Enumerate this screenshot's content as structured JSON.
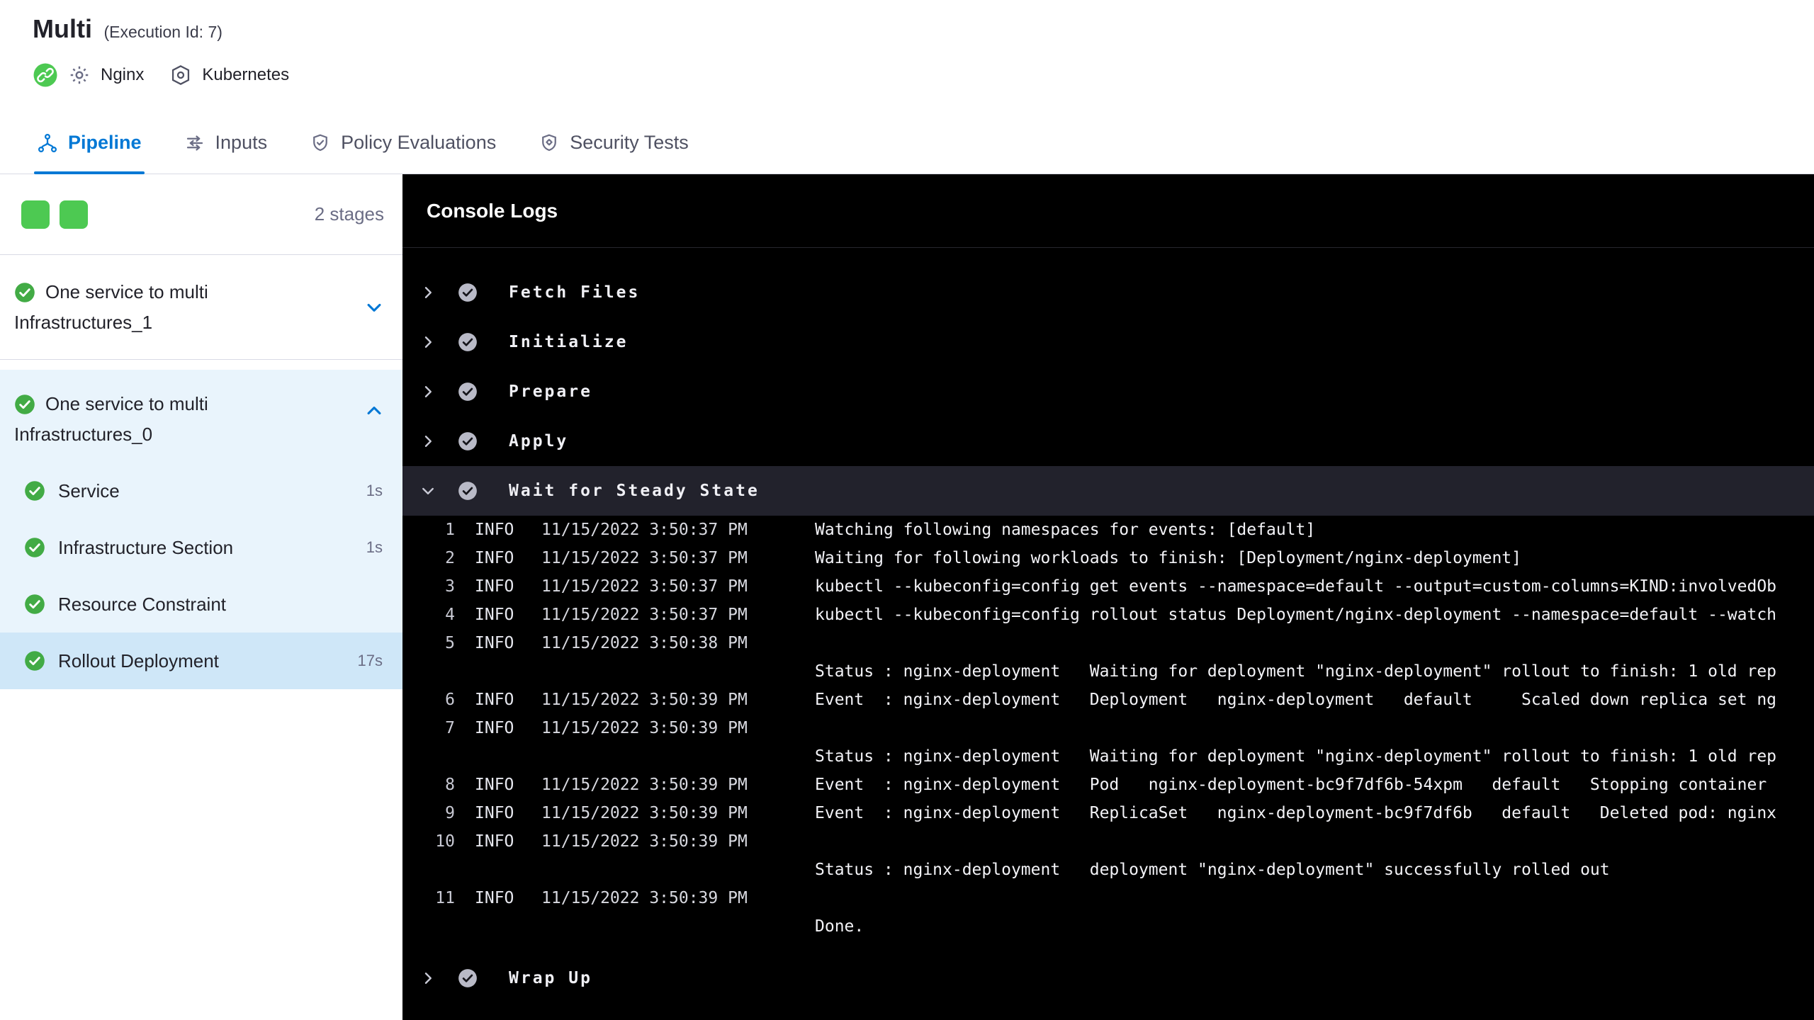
{
  "colors": {
    "accent": "#0278d5",
    "success": "#42ab45",
    "success_bright": "#4dc952",
    "muted": "#6b6d85",
    "console_icon": "#b9bac7",
    "console_highlight": "#22222c",
    "expanded_stage_bg": "#e9f4fc",
    "selected_step_bg": "#cfe7f8"
  },
  "header": {
    "title": "Multi",
    "execution_id": "(Execution Id: 7)",
    "service_icon": "service-icon",
    "gear_icon": "gear-icon",
    "service_label": "Nginx",
    "infra_icon": "kubernetes-icon",
    "infra_label": "Kubernetes"
  },
  "tabs": [
    {
      "label": "Pipeline",
      "icon": "pipeline-icon",
      "active": true
    },
    {
      "label": "Inputs",
      "icon": "inputs-icon",
      "active": false
    },
    {
      "label": "Policy Evaluations",
      "icon": "policy-evaluations-icon",
      "active": false
    },
    {
      "label": "Security Tests",
      "icon": "security-tests-icon",
      "active": false
    }
  ],
  "sidebar": {
    "stage_count": "2 stages",
    "stages": [
      {
        "name": "One service to multi Infrastructures_1",
        "status": "success",
        "expanded": false
      },
      {
        "name": "One service to multi Infrastructures_0",
        "status": "success",
        "expanded": true,
        "steps": [
          {
            "name": "Service",
            "duration": "1s",
            "selected": false
          },
          {
            "name": "Infrastructure Section",
            "duration": "1s",
            "selected": false
          },
          {
            "name": "Resource Constraint",
            "duration": "",
            "selected": false
          },
          {
            "name": "Rollout Deployment",
            "duration": "17s",
            "selected": true
          }
        ]
      }
    ]
  },
  "console": {
    "title": "Console Logs",
    "steps_before": [
      "Fetch Files",
      "Initialize",
      "Prepare",
      "Apply"
    ],
    "expanded_step": "Wait for Steady State",
    "steps_after": [
      "Wrap Up"
    ],
    "logs": [
      {
        "num": "1",
        "level": "INFO",
        "time": "11/15/2022 3:50:37 PM",
        "message": "Watching following namespaces for events: [default]"
      },
      {
        "num": "2",
        "level": "INFO",
        "time": "11/15/2022 3:50:37 PM",
        "message": "Waiting for following workloads to finish: [Deployment/nginx-deployment]"
      },
      {
        "num": "3",
        "level": "INFO",
        "time": "11/15/2022 3:50:37 PM",
        "message": "kubectl --kubeconfig=config get events --namespace=default --output=custom-columns=KIND:involvedOb"
      },
      {
        "num": "4",
        "level": "INFO",
        "time": "11/15/2022 3:50:37 PM",
        "message": "kubectl --kubeconfig=config rollout status Deployment/nginx-deployment --namespace=default --watch"
      },
      {
        "num": "5",
        "level": "INFO",
        "time": "11/15/2022 3:50:38 PM",
        "message": "",
        "continuation": "Status : nginx-deployment   Waiting for deployment \"nginx-deployment\" rollout to finish: 1 old rep"
      },
      {
        "num": "6",
        "level": "INFO",
        "time": "11/15/2022 3:50:39 PM",
        "message": "Event  : nginx-deployment   Deployment   nginx-deployment   default     Scaled down replica set ng"
      },
      {
        "num": "7",
        "level": "INFO",
        "time": "11/15/2022 3:50:39 PM",
        "message": "",
        "continuation": "Status : nginx-deployment   Waiting for deployment \"nginx-deployment\" rollout to finish: 1 old rep"
      },
      {
        "num": "8",
        "level": "INFO",
        "time": "11/15/2022 3:50:39 PM",
        "message": "Event  : nginx-deployment   Pod   nginx-deployment-bc9f7df6b-54xpm   default   Stopping container"
      },
      {
        "num": "9",
        "level": "INFO",
        "time": "11/15/2022 3:50:39 PM",
        "message": "Event  : nginx-deployment   ReplicaSet   nginx-deployment-bc9f7df6b   default   Deleted pod: nginx"
      },
      {
        "num": "10",
        "level": "INFO",
        "time": "11/15/2022 3:50:39 PM",
        "message": "",
        "continuation": "Status : nginx-deployment   deployment \"nginx-deployment\" successfully rolled out"
      },
      {
        "num": "11",
        "level": "INFO",
        "time": "11/15/2022 3:50:39 PM",
        "message": "",
        "continuation": "Done."
      }
    ]
  }
}
